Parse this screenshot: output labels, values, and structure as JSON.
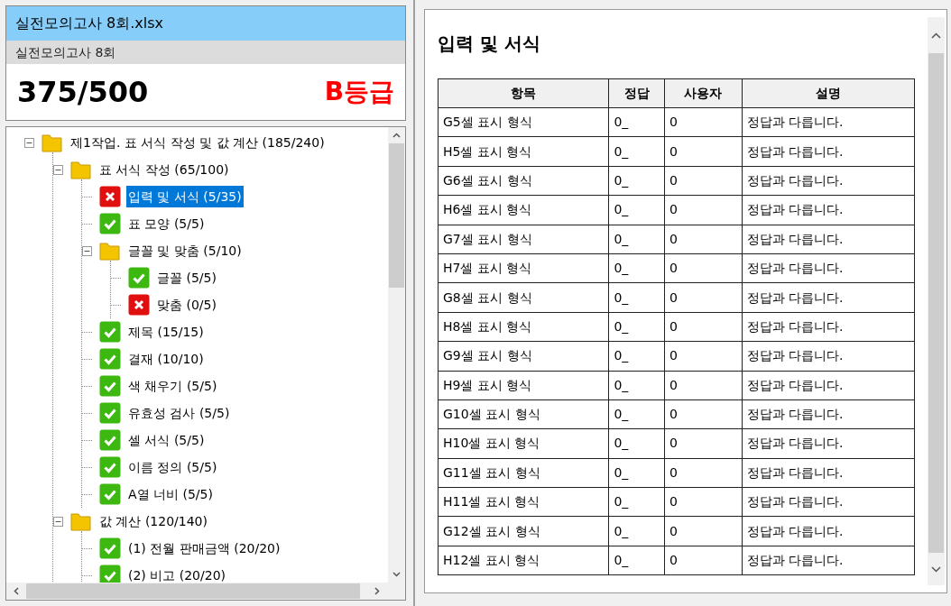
{
  "file_title": "실전모의고사 8회.xlsx",
  "exam_name": "실전모의고사 8회",
  "score": "375/500",
  "grade": "B등급",
  "tree": [
    {
      "kind": "folder",
      "label": "제1작업. 표 서식 작성 및 값 계산 (185/240)",
      "expanded": true,
      "selected": false,
      "children": [
        {
          "kind": "folder",
          "label": "표 서식 작성 (65/100)",
          "expanded": true,
          "selected": false,
          "children": [
            {
              "kind": "fail",
              "label": "입력 및 서식 (5/35)",
              "selected": true
            },
            {
              "kind": "pass",
              "label": "표 모양 (5/5)",
              "selected": false
            },
            {
              "kind": "folder",
              "label": "글꼴 및 맞춤 (5/10)",
              "expanded": true,
              "selected": false,
              "children": [
                {
                  "kind": "pass",
                  "label": "글꼴 (5/5)",
                  "selected": false
                },
                {
                  "kind": "fail",
                  "label": "맞춤 (0/5)",
                  "selected": false
                }
              ]
            },
            {
              "kind": "pass",
              "label": "제목 (15/15)",
              "selected": false
            },
            {
              "kind": "pass",
              "label": "결재 (10/10)",
              "selected": false
            },
            {
              "kind": "pass",
              "label": "색 채우기 (5/5)",
              "selected": false
            },
            {
              "kind": "pass",
              "label": "유효성 검사 (5/5)",
              "selected": false
            },
            {
              "kind": "pass",
              "label": "셀 서식 (5/5)",
              "selected": false
            },
            {
              "kind": "pass",
              "label": "이름 정의 (5/5)",
              "selected": false
            },
            {
              "kind": "pass",
              "label": "A열 너비 (5/5)",
              "selected": false
            }
          ]
        },
        {
          "kind": "folder",
          "label": "값 계산 (120/140)",
          "expanded": true,
          "selected": false,
          "children": [
            {
              "kind": "pass",
              "label": "(1) 전월 판매금액 (20/20)",
              "selected": false
            },
            {
              "kind": "pass",
              "label": "(2) 비고 (20/20)",
              "selected": false
            }
          ]
        }
      ]
    }
  ],
  "detail": {
    "title": "입력 및 서식",
    "columns": [
      "항목",
      "정답",
      "사용자",
      "설명"
    ],
    "rows": [
      [
        "G5셀 표시 형식",
        "0_",
        "0",
        "정답과 다릅니다."
      ],
      [
        "H5셀 표시 형식",
        "0_",
        "0",
        "정답과 다릅니다."
      ],
      [
        "G6셀 표시 형식",
        "0_",
        "0",
        "정답과 다릅니다."
      ],
      [
        "H6셀 표시 형식",
        "0_",
        "0",
        "정답과 다릅니다."
      ],
      [
        "G7셀 표시 형식",
        "0_",
        "0",
        "정답과 다릅니다."
      ],
      [
        "H7셀 표시 형식",
        "0_",
        "0",
        "정답과 다릅니다."
      ],
      [
        "G8셀 표시 형식",
        "0_",
        "0",
        "정답과 다릅니다."
      ],
      [
        "H8셀 표시 형식",
        "0_",
        "0",
        "정답과 다릅니다."
      ],
      [
        "G9셀 표시 형식",
        "0_",
        "0",
        "정답과 다릅니다."
      ],
      [
        "H9셀 표시 형식",
        "0_",
        "0",
        "정답과 다릅니다."
      ],
      [
        "G10셀 표시 형식",
        "0_",
        "0",
        "정답과 다릅니다."
      ],
      [
        "H10셀 표시 형식",
        "0_",
        "0",
        "정답과 다릅니다."
      ],
      [
        "G11셀 표시 형식",
        "0_",
        "0",
        "정답과 다릅니다."
      ],
      [
        "H11셀 표시 형식",
        "0_",
        "0",
        "정답과 다릅니다."
      ],
      [
        "G12셀 표시 형식",
        "0_",
        "0",
        "정답과 다릅니다."
      ],
      [
        "H12셀 표시 형식",
        "0_",
        "0",
        "정답과 다릅니다."
      ]
    ]
  }
}
